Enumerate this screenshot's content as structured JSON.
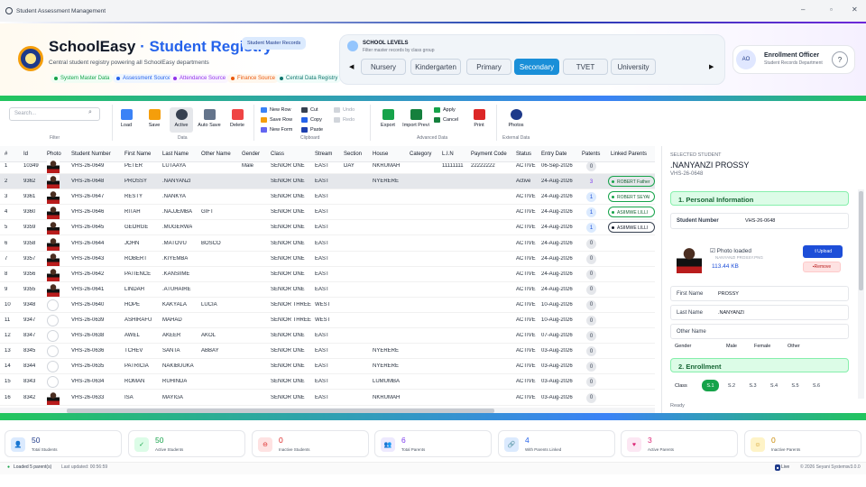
{
  "window": {
    "title": "Student Assessment Management"
  },
  "header": {
    "app_name": "SchoolEasy",
    "title_sep": "·",
    "app_section": "Student Registry",
    "badge": "Student Master Records",
    "subtitle": "Central student registry powering all SchoolEasy departments",
    "tags": [
      {
        "label": "System Master Data",
        "color": "#16a34a",
        "bg": "#f0fdf4"
      },
      {
        "label": "Assessment Source",
        "color": "#2563eb",
        "bg": "#eff6ff"
      },
      {
        "label": "Attendance Source",
        "color": "#9333ea",
        "bg": "#faf5ff"
      },
      {
        "label": "Finance Source",
        "color": "#ea580c",
        "bg": "#fff7ed"
      },
      {
        "label": "Central Data Registry",
        "color": "#0f766e",
        "bg": "#f0fdfa"
      }
    ]
  },
  "levels": {
    "title": "SCHOOL LEVELS",
    "subtitle": "Filter master records by class group",
    "items": [
      "Nursery",
      "Kindergarten",
      "Primary",
      "Secondary",
      "TVET",
      "University"
    ],
    "selected": "Secondary",
    "prev": "◀",
    "next": "▶"
  },
  "officer": {
    "initials": "AO",
    "title": "Enrollment Officer",
    "dept": "Student Records Department",
    "help": "?"
  },
  "toolbar": {
    "search_placeholder": "Search...",
    "filter_label": "Filter",
    "data_label": "Data",
    "clipboard_label": "Clipboard",
    "advanced_label": "Advanced Data",
    "external_label": "External Data",
    "load": "Load",
    "save": "Save",
    "active": "Active",
    "autosave": "Auto Save",
    "delete": "Delete",
    "new_row": "New Row",
    "save_row": "Save Row",
    "new_form": "New Form",
    "cut": "Cut",
    "copy": "Copy",
    "paste": "Paste",
    "undo": "Undo",
    "redo": "Redo",
    "export": "Export",
    "import": "Import Previ",
    "apply": "Apply",
    "cancel": "Cancel",
    "print": "Print",
    "photos": "Photos"
  },
  "grid": {
    "columns": [
      "#",
      "Id",
      "Photo",
      "Student Number",
      "First Name",
      "Last Name",
      "Other Name",
      "Gender",
      "Class",
      "Stream",
      "Section",
      "House",
      "Category",
      "L.I.N",
      "Payment Code",
      "Status",
      "Entry Date",
      "Patents",
      "Linked Parents"
    ],
    "rows": [
      {
        "n": "1",
        "id": "10349",
        "photo": true,
        "num": "VHS-26-0649",
        "first": "PETER",
        "last": "LUTAAYA",
        "other": "",
        "gender": "Male",
        "class": "SENIOR ONE",
        "stream": "EAST",
        "section": "DAY",
        "house": "NKRUMAH",
        "cat": "",
        "lin": "11111111",
        "pay": "22222222",
        "status": "ACTIVE",
        "date": "06-Sep-2026",
        "parents": "0",
        "linked": "",
        "lstyle": ""
      },
      {
        "n": "2",
        "id": "9362",
        "photo": true,
        "num": "VHS-26-0648",
        "first": "PROSSY",
        "last": ".NANYANZI",
        "other": "",
        "gender": "",
        "class": "SENIOR ONE",
        "stream": "EAST",
        "section": "",
        "house": "NYERERE",
        "cat": "",
        "lin": "",
        "pay": "",
        "status": "Active",
        "date": "24-Aug-2026",
        "parents": "3",
        "linked": "ROBERT Father",
        "lstyle": "green"
      },
      {
        "n": "3",
        "id": "9361",
        "photo": true,
        "num": "VHS-26-0647",
        "first": "RESTY",
        "last": ".NANKYA",
        "other": "",
        "gender": "",
        "class": "SENIOR ONE",
        "stream": "EAST",
        "section": "",
        "house": "",
        "cat": "",
        "lin": "",
        "pay": "",
        "status": "ACTIVE",
        "date": "24-Aug-2026",
        "parents": "1",
        "linked": "ROBERT SEYAI",
        "lstyle": "green"
      },
      {
        "n": "4",
        "id": "9360",
        "photo": true,
        "num": "VHS-26-0646",
        "first": "RITAH",
        "last": ".NAJJEMBA",
        "other": "GIFT",
        "gender": "",
        "class": "SENIOR ONE",
        "stream": "EAST",
        "section": "",
        "house": "",
        "cat": "",
        "lin": "",
        "pay": "",
        "status": "ACTIVE",
        "date": "24-Aug-2026",
        "parents": "1",
        "linked": "ASIIMWE LILLI",
        "lstyle": "green"
      },
      {
        "n": "5",
        "id": "9359",
        "photo": true,
        "num": "VHS-26-0645",
        "first": "GEORGE",
        "last": ".MUGERWA",
        "other": "",
        "gender": "",
        "class": "SENIOR ONE",
        "stream": "EAST",
        "section": "",
        "house": "",
        "cat": "",
        "lin": "",
        "pay": "",
        "status": "ACTIVE",
        "date": "24-Aug-2026",
        "parents": "1",
        "linked": "ASIIMWE LILLI",
        "lstyle": "dark"
      },
      {
        "n": "6",
        "id": "9358",
        "photo": true,
        "num": "VHS-26-0644",
        "first": "JOHN",
        "last": ".MATOVU",
        "other": "BOSCO",
        "gender": "",
        "class": "SENIOR ONE",
        "stream": "EAST",
        "section": "",
        "house": "",
        "cat": "",
        "lin": "",
        "pay": "",
        "status": "ACTIVE",
        "date": "24-Aug-2026",
        "parents": "0",
        "linked": "",
        "lstyle": ""
      },
      {
        "n": "7",
        "id": "9357",
        "photo": true,
        "num": "VHS-26-0643",
        "first": "ROBERT",
        "last": ".KIYEMBA",
        "other": "",
        "gender": "",
        "class": "SENIOR ONE",
        "stream": "EAST",
        "section": "",
        "house": "",
        "cat": "",
        "lin": "",
        "pay": "",
        "status": "ACTIVE",
        "date": "24-Aug-2026",
        "parents": "0",
        "linked": "",
        "lstyle": ""
      },
      {
        "n": "8",
        "id": "9356",
        "photo": true,
        "num": "VHS-26-0642",
        "first": "PATIENCE",
        "last": ".KANSIIME",
        "other": "",
        "gender": "",
        "class": "SENIOR ONE",
        "stream": "EAST",
        "section": "",
        "house": "",
        "cat": "",
        "lin": "",
        "pay": "",
        "status": "ACTIVE",
        "date": "24-Aug-2026",
        "parents": "0",
        "linked": "",
        "lstyle": ""
      },
      {
        "n": "9",
        "id": "9355",
        "photo": true,
        "num": "VHS-26-0641",
        "first": "LINDAH",
        "last": ".ATUHAIRE",
        "other": "",
        "gender": "",
        "class": "SENIOR ONE",
        "stream": "EAST",
        "section": "",
        "house": "",
        "cat": "",
        "lin": "",
        "pay": "",
        "status": "ACTIVE",
        "date": "24-Aug-2026",
        "parents": "0",
        "linked": "",
        "lstyle": ""
      },
      {
        "n": "10",
        "id": "9348",
        "photo": false,
        "num": "VHS-26-0640",
        "first": "HOPE",
        "last": "KAKYALA",
        "other": "LUCIA",
        "gender": "",
        "class": "SENIOR THREE",
        "stream": "WEST",
        "section": "",
        "house": "",
        "cat": "",
        "lin": "",
        "pay": "",
        "status": "ACTIVE",
        "date": "10-Aug-2026",
        "parents": "0",
        "linked": "",
        "lstyle": ""
      },
      {
        "n": "11",
        "id": "9347",
        "photo": false,
        "num": "VHS-26-0639",
        "first": "ASHIRAFU",
        "last": "MAHAD",
        "other": "",
        "gender": "",
        "class": "SENIOR THREE",
        "stream": "WEST",
        "section": "",
        "house": "",
        "cat": "",
        "lin": "",
        "pay": "",
        "status": "ACTIVE",
        "date": "10-Aug-2026",
        "parents": "0",
        "linked": "",
        "lstyle": ""
      },
      {
        "n": "12",
        "id": "8347",
        "photo": false,
        "num": "VHS-26-0638",
        "first": "AWEL",
        "last": "AKEER",
        "other": "AKOL",
        "gender": "",
        "class": "SENIOR ONE",
        "stream": "EAST",
        "section": "",
        "house": "",
        "cat": "",
        "lin": "",
        "pay": "",
        "status": "ACTIVE",
        "date": "07-Aug-2026",
        "parents": "0",
        "linked": "",
        "lstyle": ""
      },
      {
        "n": "13",
        "id": "8345",
        "photo": false,
        "num": "VHS-26-0636",
        "first": "TCHEV",
        "last": "SANTA",
        "other": "ABBAY",
        "gender": "",
        "class": "SENIOR ONE",
        "stream": "EAST",
        "section": "",
        "house": "NYERERE",
        "cat": "",
        "lin": "",
        "pay": "",
        "status": "ACTIVE",
        "date": "03-Aug-2026",
        "parents": "0",
        "linked": "",
        "lstyle": ""
      },
      {
        "n": "14",
        "id": "8344",
        "photo": false,
        "num": "VHS-26-0635",
        "first": "PATRICIA",
        "last": "NAKIBUUKA",
        "other": "",
        "gender": "",
        "class": "SENIOR ONE",
        "stream": "EAST",
        "section": "",
        "house": "NYERERE",
        "cat": "",
        "lin": "",
        "pay": "",
        "status": "ACTIVE",
        "date": "03-Aug-2026",
        "parents": "0",
        "linked": "",
        "lstyle": ""
      },
      {
        "n": "15",
        "id": "8343",
        "photo": false,
        "num": "VHS-26-0634",
        "first": "ROMAN",
        "last": "RUHINDA",
        "other": "",
        "gender": "",
        "class": "SENIOR ONE",
        "stream": "EAST",
        "section": "",
        "house": "LUMUMBA",
        "cat": "",
        "lin": "",
        "pay": "",
        "status": "ACTIVE",
        "date": "03-Aug-2026",
        "parents": "0",
        "linked": "",
        "lstyle": ""
      },
      {
        "n": "16",
        "id": "8342",
        "photo": true,
        "num": "VHS-26-0633",
        "first": "ISA",
        "last": "MAYIGA",
        "other": "",
        "gender": "",
        "class": "SENIOR ONE",
        "stream": "EAST",
        "section": "",
        "house": "NKRUMAH",
        "cat": "",
        "lin": "",
        "pay": "",
        "status": "ACTIVE",
        "date": "03-Aug-2026",
        "parents": "0",
        "linked": "",
        "lstyle": ""
      }
    ]
  },
  "panel": {
    "heading": "SELECTED STUDENT",
    "name": ".NANYANZI PROSSY",
    "number": "VHS-26-0648",
    "sec1": "1.  Personal Information",
    "sn_label": "Student Number",
    "sn_value": "VHS-26-0648",
    "photo_status": "Photo loaded",
    "photo_file": "NANYANZI PROSSY.PNG",
    "photo_size": "113.44 KB",
    "upload": "Upload",
    "remove": "Remove",
    "first_label": "First Name",
    "first_value": "PROSSY",
    "last_label": "Last Name",
    "last_value": ".NANYANZI",
    "other_label": "Other Name",
    "other_value": "",
    "gender_label": "Gender",
    "genders": [
      "Male",
      "Female",
      "Other"
    ],
    "sec2": "2.  Enrollment",
    "class_label": "Class",
    "classes": [
      "S.1",
      "S.2",
      "S.3",
      "S.4",
      "S.5",
      "S.6"
    ],
    "selected_class": "S.1",
    "status": "Ready"
  },
  "stats": [
    {
      "value": "50",
      "label": "Total Students",
      "color": "#1e3a8a",
      "bg": "#dbeafe",
      "icon": "👤"
    },
    {
      "value": "50",
      "label": "Active Students",
      "color": "#16a34a",
      "bg": "#dcfce7",
      "icon": "✓"
    },
    {
      "value": "0",
      "label": "Inactive Students",
      "color": "#dc2626",
      "bg": "#fee2e2",
      "icon": "⊖"
    },
    {
      "value": "6",
      "label": "Total Parents",
      "color": "#7c3aed",
      "bg": "#ede9fe",
      "icon": "👥"
    },
    {
      "value": "4",
      "label": "With Parents Linked",
      "color": "#2563eb",
      "bg": "#dbeafe",
      "icon": "🔗"
    },
    {
      "value": "3",
      "label": "Active Parents",
      "color": "#db2777",
      "bg": "#fce7f3",
      "icon": "♥"
    },
    {
      "value": "0",
      "label": "Inactive Parents",
      "color": "#ca8a04",
      "bg": "#fef3c7",
      "icon": "☺"
    }
  ],
  "statusbar": {
    "loaded": "Loaded 5 parent(s)",
    "updated": "Last updated: 00:56:59",
    "live": "Live",
    "copyright": "© 2026 Seyani Systems",
    "version": "v3.0.0"
  }
}
